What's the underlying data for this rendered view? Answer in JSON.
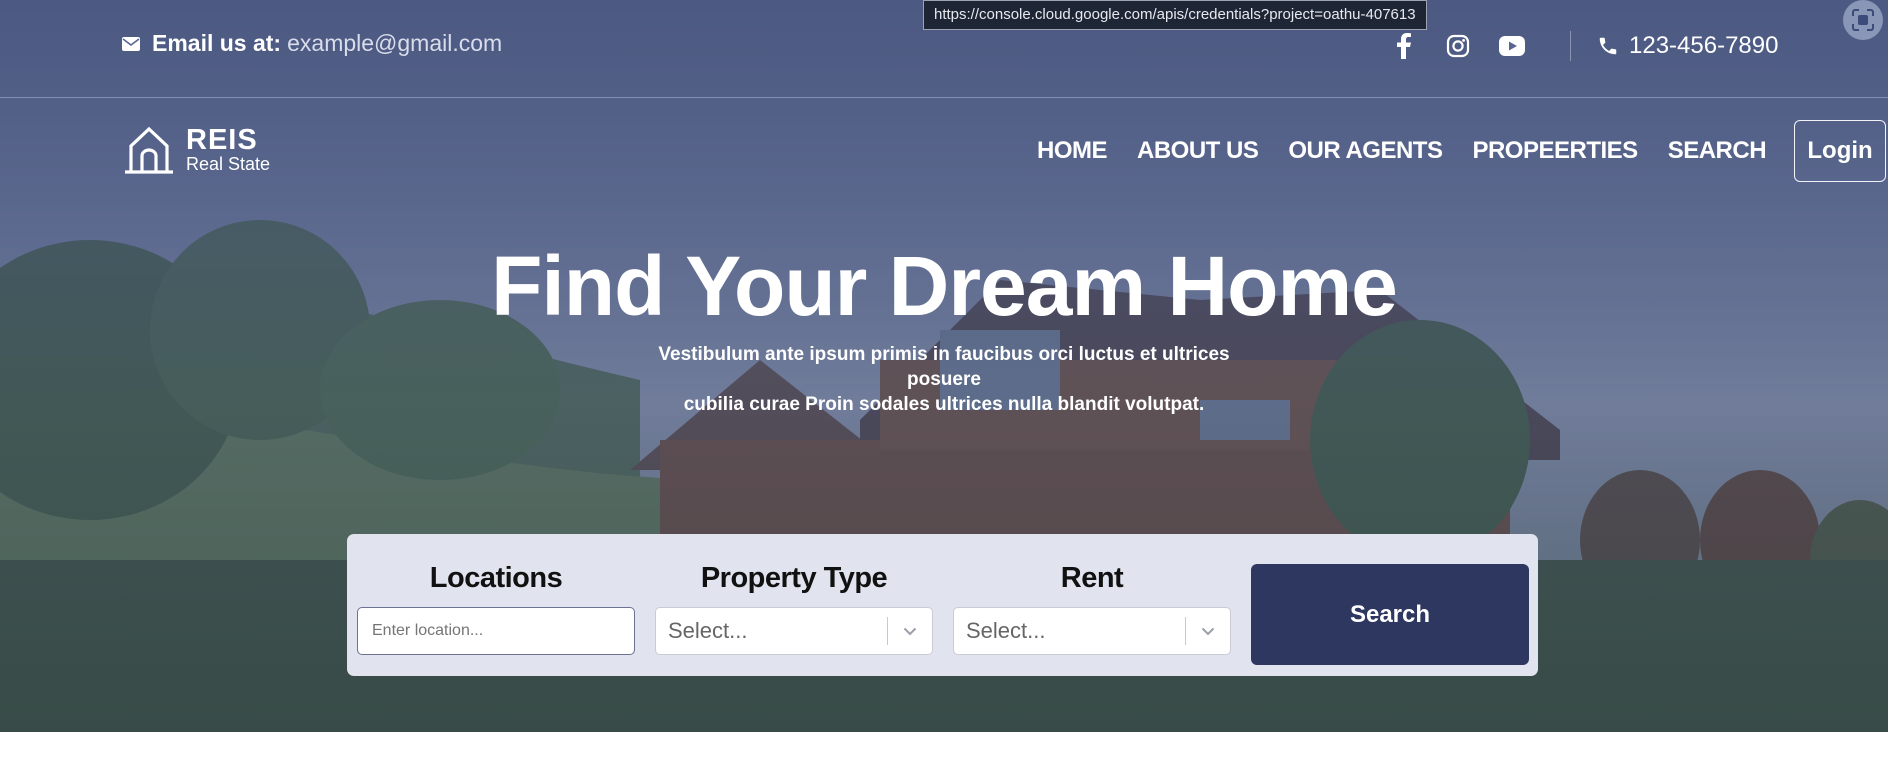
{
  "browser": {
    "status_url": "https://console.cloud.google.com/apis/credentials?project=oathu-407613"
  },
  "topbar": {
    "email_label": "Email us at:",
    "email_value": "example@gmail.com",
    "phone": "123-456-7890",
    "socials": [
      "facebook-icon",
      "instagram-icon",
      "youtube-icon"
    ]
  },
  "brand": {
    "name": "REIS",
    "tagline": "Real State"
  },
  "nav": {
    "items": [
      "HOME",
      "ABOUT US",
      "OUR AGENTS",
      "PROPEERTIES",
      "SEARCH"
    ],
    "login_label": "Login"
  },
  "hero": {
    "title": "Find Your Dream Home",
    "subtitle_line1": "Vestibulum ante ipsum primis in faucibus orci luctus et ultrices posuere",
    "subtitle_line2": "cubilia curae Proin sodales ultrices nulla blandit volutpat."
  },
  "search": {
    "location_label": "Locations",
    "location_placeholder": "Enter location...",
    "property_label": "Property Type",
    "property_value": "Select...",
    "rent_label": "Rent",
    "rent_value": "Select...",
    "button_label": "Search"
  },
  "colors": {
    "panel_bg": "#e1e4ee",
    "button_bg": "#2e3760",
    "overlay": "#48547c"
  }
}
